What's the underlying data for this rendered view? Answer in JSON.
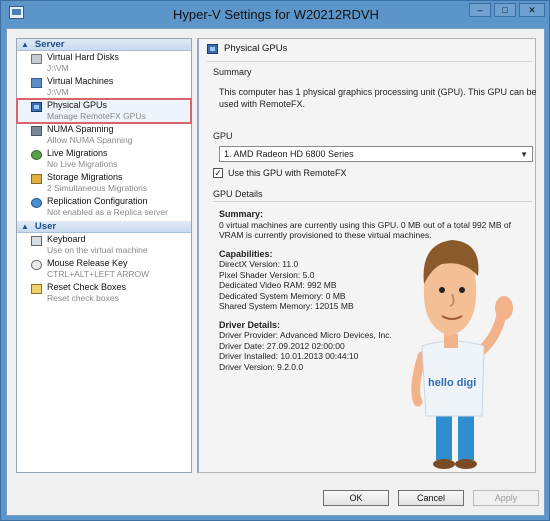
{
  "window": {
    "title": "Hyper-V Settings for W20212RDVH"
  },
  "nav": {
    "server_header": "Server",
    "server_items": [
      {
        "label": "Virtual Hard Disks",
        "sub": "J:\\VM"
      },
      {
        "label": "Virtual Machines",
        "sub": "J:\\VM"
      },
      {
        "label": "Physical GPUs",
        "sub": "Manage RemoteFX GPUs"
      },
      {
        "label": "NUMA Spanning",
        "sub": "Allow NUMA Spanning"
      },
      {
        "label": "Live Migrations",
        "sub": "No Live Migrations"
      },
      {
        "label": "Storage Migrations",
        "sub": "2 Simultaneous Migrations"
      },
      {
        "label": "Replication Configuration",
        "sub": "Not enabled as a Replica server"
      }
    ],
    "user_header": "User",
    "user_items": [
      {
        "label": "Keyboard",
        "sub": "Use on the virtual machine"
      },
      {
        "label": "Mouse Release Key",
        "sub": "CTRL+ALT+LEFT ARROW"
      },
      {
        "label": "Reset Check Boxes",
        "sub": "Reset check boxes"
      }
    ]
  },
  "panel": {
    "title": "Physical GPUs",
    "summary_label": "Summary",
    "summary_text": "This computer has 1 physical graphics processing unit (GPU). This GPU can be used with RemoteFX.",
    "gpu_label": "GPU",
    "gpu_selected": "1. AMD Radeon HD 6800 Series",
    "use_gpu_label": "Use this GPU with RemoteFX",
    "details_label": "GPU Details",
    "details": {
      "summary_heading": "Summary:",
      "summary_lines": [
        "0 virtual machines are currently using this GPU. 0 MB out of a total 992 MB of",
        "VRAM is currently provisioned to these virtual machines."
      ],
      "capabilities_heading": "Capabilities:",
      "capabilities_lines": [
        "DirectX Version: 11.0",
        "Pixel Shader Version: 5.0",
        "Dedicated Video RAM: 992 MB",
        "Dedicated System Memory: 0 MB",
        "Shared System Memory: 12015 MB"
      ],
      "driver_heading": "Driver Details:",
      "driver_lines": [
        "Driver Provider: Advanced Micro Devices, Inc.",
        "Driver Date: 27.09.2012 02:00:00",
        "Driver Installed: 10.01.2013 00:44:10",
        "Driver Version: 9.2.0.0"
      ]
    }
  },
  "mascot": {
    "shirt_text": "hello digi"
  },
  "footer": {
    "ok": "OK",
    "cancel": "Cancel",
    "apply": "Apply"
  },
  "win_buttons": {
    "minimize": "–",
    "maximize": "□",
    "close": "✕"
  },
  "colors": {
    "selection_outline": "#d9646a",
    "title_bar": "#5c95c9",
    "nav_header": "#1f4e8c"
  }
}
